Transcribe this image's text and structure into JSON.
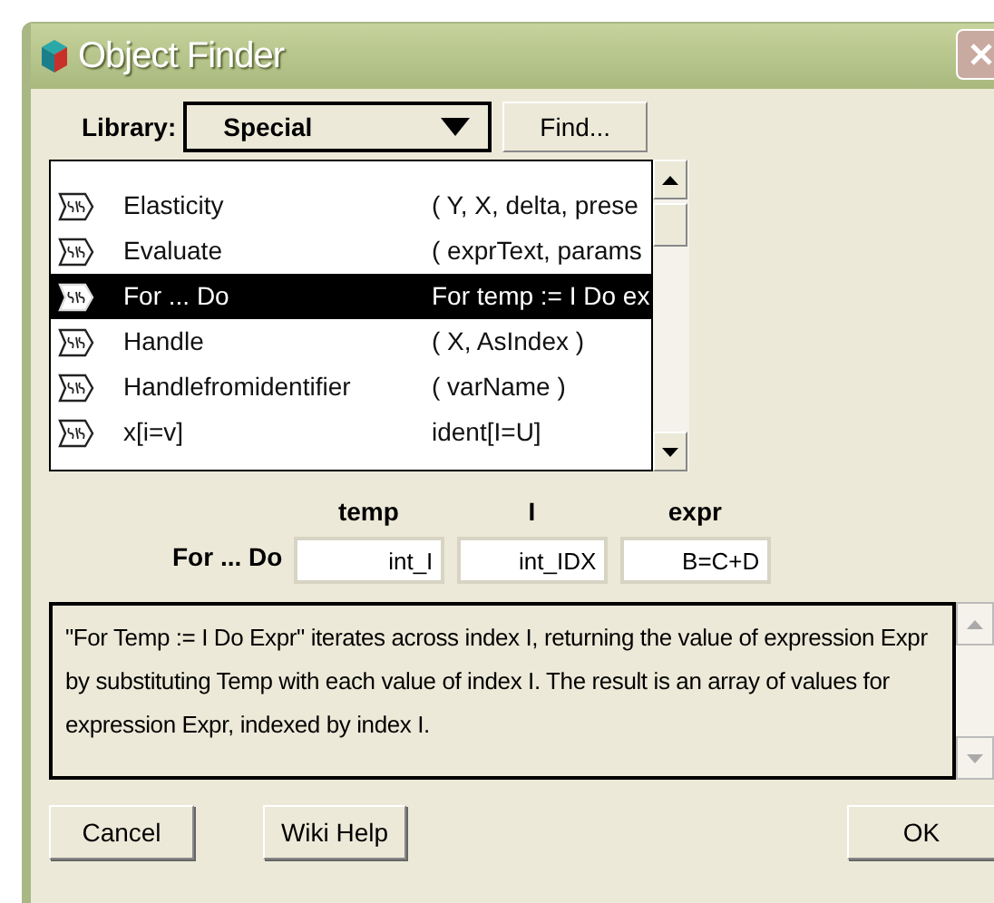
{
  "window": {
    "title": "Object Finder"
  },
  "library": {
    "label": "Library:",
    "value": "Special",
    "find_button": "Find..."
  },
  "list": {
    "items": [
      {
        "name": "Elasticity",
        "params": "( Y, X, delta, prese",
        "selected": false
      },
      {
        "name": "Evaluate",
        "params": "( exprText, params",
        "selected": false
      },
      {
        "name": "For ... Do",
        "params": "For temp := I Do ex",
        "selected": true
      },
      {
        "name": "Handle",
        "params": "( X, AsIndex )",
        "selected": false
      },
      {
        "name": "Handlefromidentifier",
        "params": "( varName )",
        "selected": false
      },
      {
        "name": "x[i=v]",
        "params": "ident[I=U]",
        "selected": false
      }
    ]
  },
  "parameters": {
    "label": "For ... Do",
    "fields": [
      {
        "heading": "temp",
        "value": "int_I"
      },
      {
        "heading": "I",
        "value": "int_IDX"
      },
      {
        "heading": "expr",
        "value": "B=C+D"
      }
    ]
  },
  "description": "\"For Temp := I Do Expr\" iterates across index I, returning the value of expression Expr by substituting Temp with each value of index I. The result is an array of values for expression Expr, indexed by index I.",
  "buttons": [
    "Cancel",
    "Wiki Help",
    "OK"
  ]
}
